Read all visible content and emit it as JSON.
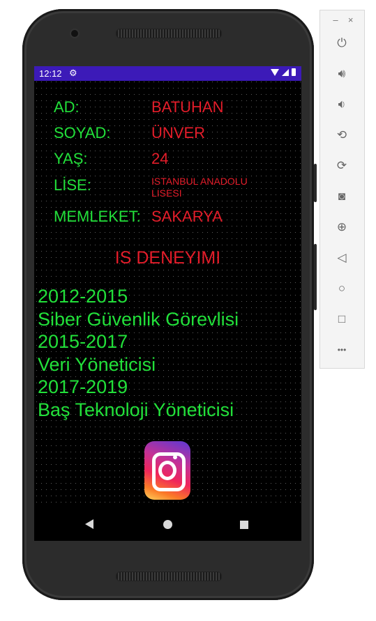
{
  "status_bar": {
    "time": "12:12"
  },
  "profile": {
    "rows": [
      {
        "label": "AD:",
        "value": "BATUHAN"
      },
      {
        "label": "SOYAD:",
        "value": "ÜNVER"
      },
      {
        "label": "YAŞ:",
        "value": "24"
      },
      {
        "label": "LİSE:",
        "value": "ISTANBUL ANADOLU LISESI"
      },
      {
        "label": "MEMLEKET:",
        "value": "SAKARYA"
      }
    ]
  },
  "experience": {
    "title": "IS DENEYIMI",
    "lines": [
      "2012-2015",
      "Siber Güvenlik Görevlisi",
      "2015-2017",
      "Veri Yöneticisi",
      "2017-2019",
      "Baş Teknoloji Yöneticisi"
    ]
  },
  "icons": {
    "instagram": "instagram-icon",
    "settings": "gear-icon",
    "nav_back": "back-icon",
    "nav_home": "home-icon",
    "nav_recent": "recents-icon"
  },
  "colors": {
    "label": "#22e03a",
    "value": "#e41d2a",
    "status_bar": "#3c1ab8",
    "screen_bg": "#000000"
  },
  "emulator_toolbar": {
    "minimize": "–",
    "close": "×",
    "more": "•••"
  }
}
